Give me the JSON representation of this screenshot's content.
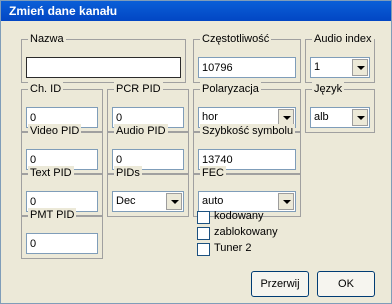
{
  "window": {
    "title": "Zmień dane kanału"
  },
  "fields": {
    "nazwa": {
      "label": "Nazwa",
      "value": ""
    },
    "czestotliwosc": {
      "label": "Częstotliwość",
      "value": "10796"
    },
    "audio_index": {
      "label": "Audio index",
      "value": "1"
    },
    "ch_id": {
      "label": "Ch. ID",
      "value": "0"
    },
    "pcr_pid": {
      "label": "PCR PID",
      "value": "0"
    },
    "polaryzacja": {
      "label": "Polaryzacja",
      "value": "hor"
    },
    "jezyk": {
      "label": "Język",
      "value": "alb"
    },
    "video_pid": {
      "label": "Video PID",
      "value": "0"
    },
    "audio_pid": {
      "label": "Audio PID",
      "value": "0"
    },
    "szybkosc": {
      "label": "Szybkość symbolu",
      "value": "13740"
    },
    "text_pid": {
      "label": "Text PID",
      "value": "0"
    },
    "pids": {
      "label": "PIDs",
      "value": "Dec"
    },
    "fec": {
      "label": "FEC",
      "value": "auto"
    },
    "pmt_pid": {
      "label": "PMT PID",
      "value": "0"
    }
  },
  "checkboxes": {
    "kodowany": {
      "label": "kodowany",
      "checked": false
    },
    "zablokowany": {
      "label": "zablokowany",
      "checked": false
    },
    "tuner2": {
      "label": "Tuner 2",
      "checked": false
    }
  },
  "buttons": {
    "przerwij": "Przerwij",
    "ok": "OK"
  },
  "colors": {
    "title_bar": "#0a5fd8",
    "face": "#ece9d8",
    "field_border": "#7f9db9"
  }
}
